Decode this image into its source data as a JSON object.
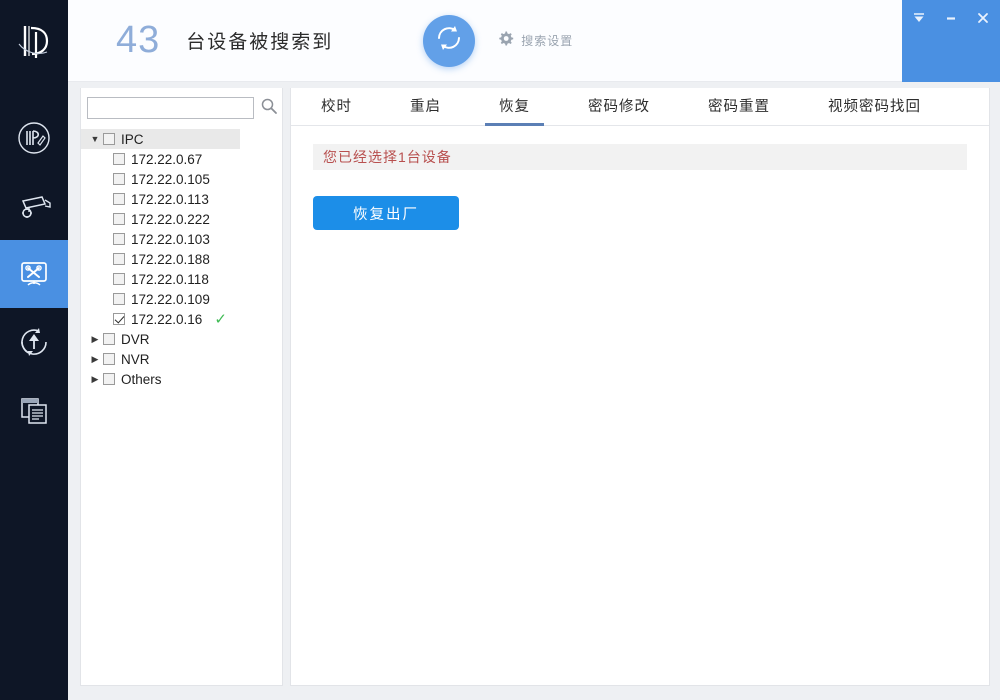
{
  "header": {
    "device_count": "43",
    "count_suffix": "台设备被搜索到",
    "refresh_icon": "refresh-icon",
    "search_settings_label": "搜索设置",
    "gear_icon": "gear-icon"
  },
  "window_controls": {
    "collapse_label": "▼",
    "minimize_label": "–",
    "close_label": "✕"
  },
  "rail": {
    "logo_name": "app-logo",
    "items": [
      {
        "name": "ip-edit",
        "icon": "ip-edit-icon",
        "active": false
      },
      {
        "name": "device-config",
        "icon": "camera-gear-icon",
        "active": false
      },
      {
        "name": "device-tools",
        "icon": "monitor-tools-icon",
        "active": true
      },
      {
        "name": "device-upgrade",
        "icon": "upload-refresh-icon",
        "active": false
      },
      {
        "name": "device-logs",
        "icon": "documents-icon",
        "active": false
      }
    ]
  },
  "search": {
    "value": "",
    "placeholder": "",
    "icon": "search-icon"
  },
  "tree": {
    "groups": [
      {
        "label": "IPC",
        "expanded": true,
        "checked": false,
        "selected": true,
        "children": [
          {
            "label": "172.22.0.67",
            "checked": false,
            "ok": false
          },
          {
            "label": "172.22.0.105",
            "checked": false,
            "ok": false
          },
          {
            "label": "172.22.0.113",
            "checked": false,
            "ok": false
          },
          {
            "label": "172.22.0.222",
            "checked": false,
            "ok": false
          },
          {
            "label": "172.22.0.103",
            "checked": false,
            "ok": false
          },
          {
            "label": "172.22.0.188",
            "checked": false,
            "ok": false
          },
          {
            "label": "172.22.0.118",
            "checked": false,
            "ok": false
          },
          {
            "label": "172.22.0.109",
            "checked": false,
            "ok": false
          },
          {
            "label": "172.22.0.16",
            "checked": true,
            "ok": true
          }
        ]
      },
      {
        "label": "DVR",
        "expanded": false,
        "checked": false,
        "selected": false,
        "children": []
      },
      {
        "label": "NVR",
        "expanded": false,
        "checked": false,
        "selected": false,
        "children": []
      },
      {
        "label": "Others",
        "expanded": false,
        "checked": false,
        "selected": false,
        "children": []
      }
    ],
    "ok_mark": "✓"
  },
  "tabs": [
    {
      "label": "校时",
      "active": false
    },
    {
      "label": "重启",
      "active": false
    },
    {
      "label": "恢复",
      "active": true
    },
    {
      "label": "密码修改",
      "active": false
    },
    {
      "label": "密码重置",
      "active": false
    },
    {
      "label": "视频密码找回",
      "active": false
    }
  ],
  "content": {
    "notice": "您已经选择1台设备",
    "action_button": "恢复出厂"
  },
  "colors": {
    "accent_blue": "#1c8ee8",
    "rail_dark": "#0e1626",
    "active_rail": "#4a90e2",
    "notice_red": "#b8504f",
    "count_blue": "#8fadd9",
    "ok_green": "#3fbb54",
    "tab_underline": "#5b7fb5"
  }
}
